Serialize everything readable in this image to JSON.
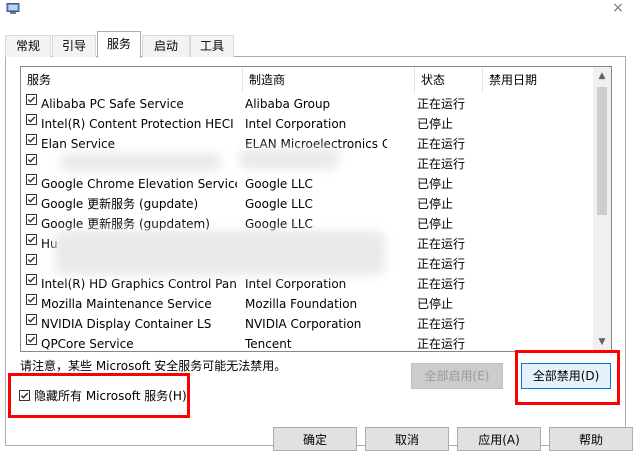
{
  "window": {
    "close_label": "×",
    "icon": "msconfig-computer-icon"
  },
  "tabs": [
    {
      "label": "常规",
      "active": false
    },
    {
      "label": "引导",
      "active": false
    },
    {
      "label": "服务",
      "active": true
    },
    {
      "label": "启动",
      "active": false
    },
    {
      "label": "工具",
      "active": false
    }
  ],
  "table": {
    "headers": {
      "name": "服务",
      "maker": "制造商",
      "status": "状态",
      "date": "禁用日期"
    },
    "rows": [
      {
        "name": "Alibaba PC Safe Service",
        "maker": "Alibaba Group",
        "status": "正在运行",
        "checked": true
      },
      {
        "name": "Intel(R) Content Protection HECI ...",
        "maker": "Intel Corporation",
        "status": "已停止",
        "checked": true
      },
      {
        "name": "Elan Service",
        "maker": "ELAN Microelectronics Cor...",
        "status": "正在运行",
        "checked": true
      },
      {
        "name": "",
        "maker": "",
        "status": "正在运行",
        "checked": true
      },
      {
        "name": "Google Chrome Elevation Service",
        "maker": "Google LLC",
        "status": "已停止",
        "checked": true
      },
      {
        "name": "Google 更新服务 (gupdate)",
        "maker": "Google LLC",
        "status": "已停止",
        "checked": true
      },
      {
        "name": "Google 更新服务 (gupdatem)",
        "maker": "Google LLC",
        "status": "已停止",
        "checked": true
      },
      {
        "name": "Hu",
        "maker": "",
        "status": "正在运行",
        "checked": true
      },
      {
        "name": "",
        "maker": "",
        "status": "正在运行",
        "checked": true
      },
      {
        "name": "Intel(R) HD Graphics Control Pan...",
        "maker": "Intel Corporation",
        "status": "正在运行",
        "checked": true
      },
      {
        "name": "Mozilla Maintenance Service",
        "maker": "Mozilla Foundation",
        "status": "已停止",
        "checked": true
      },
      {
        "name": "NVIDIA Display Container LS",
        "maker": "NVIDIA Corporation",
        "status": "正在运行",
        "checked": true
      },
      {
        "name": "QPCore Service",
        "maker": "Tencent",
        "status": "正在运行",
        "checked": true
      }
    ]
  },
  "note": "请注意，某些 Microsoft 安全服务可能无法禁用。",
  "hide_ms_label": "隐藏所有 Microsoft 服务(H)",
  "hide_ms_checked": true,
  "buttons": {
    "enable_all": "全部启用(E)",
    "disable_all": "全部禁用(D)",
    "bottom": [
      "确定",
      "取消",
      "应用(A)",
      "帮助"
    ]
  },
  "colors": {
    "highlight_box": "#ff0000",
    "focus_border": "#0078d7"
  }
}
